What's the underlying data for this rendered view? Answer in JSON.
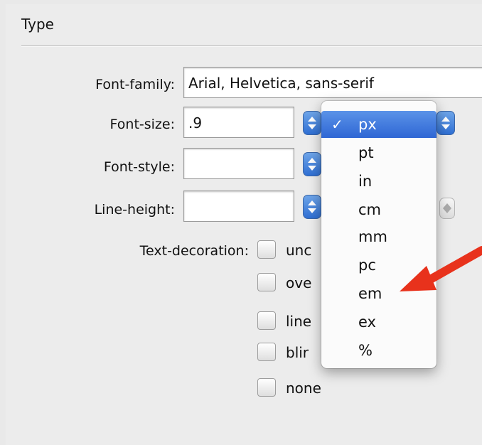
{
  "section": {
    "title": "Type"
  },
  "fields": {
    "font_family": {
      "label": "Font-family:",
      "value": "Arial, Helvetica, sans-serif"
    },
    "font_size": {
      "label": "Font-size:",
      "value": ".9"
    },
    "font_style": {
      "label": "Font-style:",
      "value": ""
    },
    "line_height": {
      "label": "Line-height:",
      "value": ""
    }
  },
  "text_decoration": {
    "label": "Text-decoration:",
    "options": [
      "unc",
      "ove",
      "line",
      "blir",
      "none"
    ]
  },
  "unit_menu": {
    "selected": "px",
    "check_mark": "✓",
    "items": [
      "px",
      "pt",
      "in",
      "cm",
      "mm",
      "pc",
      "em",
      "ex",
      "%"
    ]
  },
  "colors": {
    "accent": "#2e66d4",
    "arrow": "#e8321c"
  }
}
